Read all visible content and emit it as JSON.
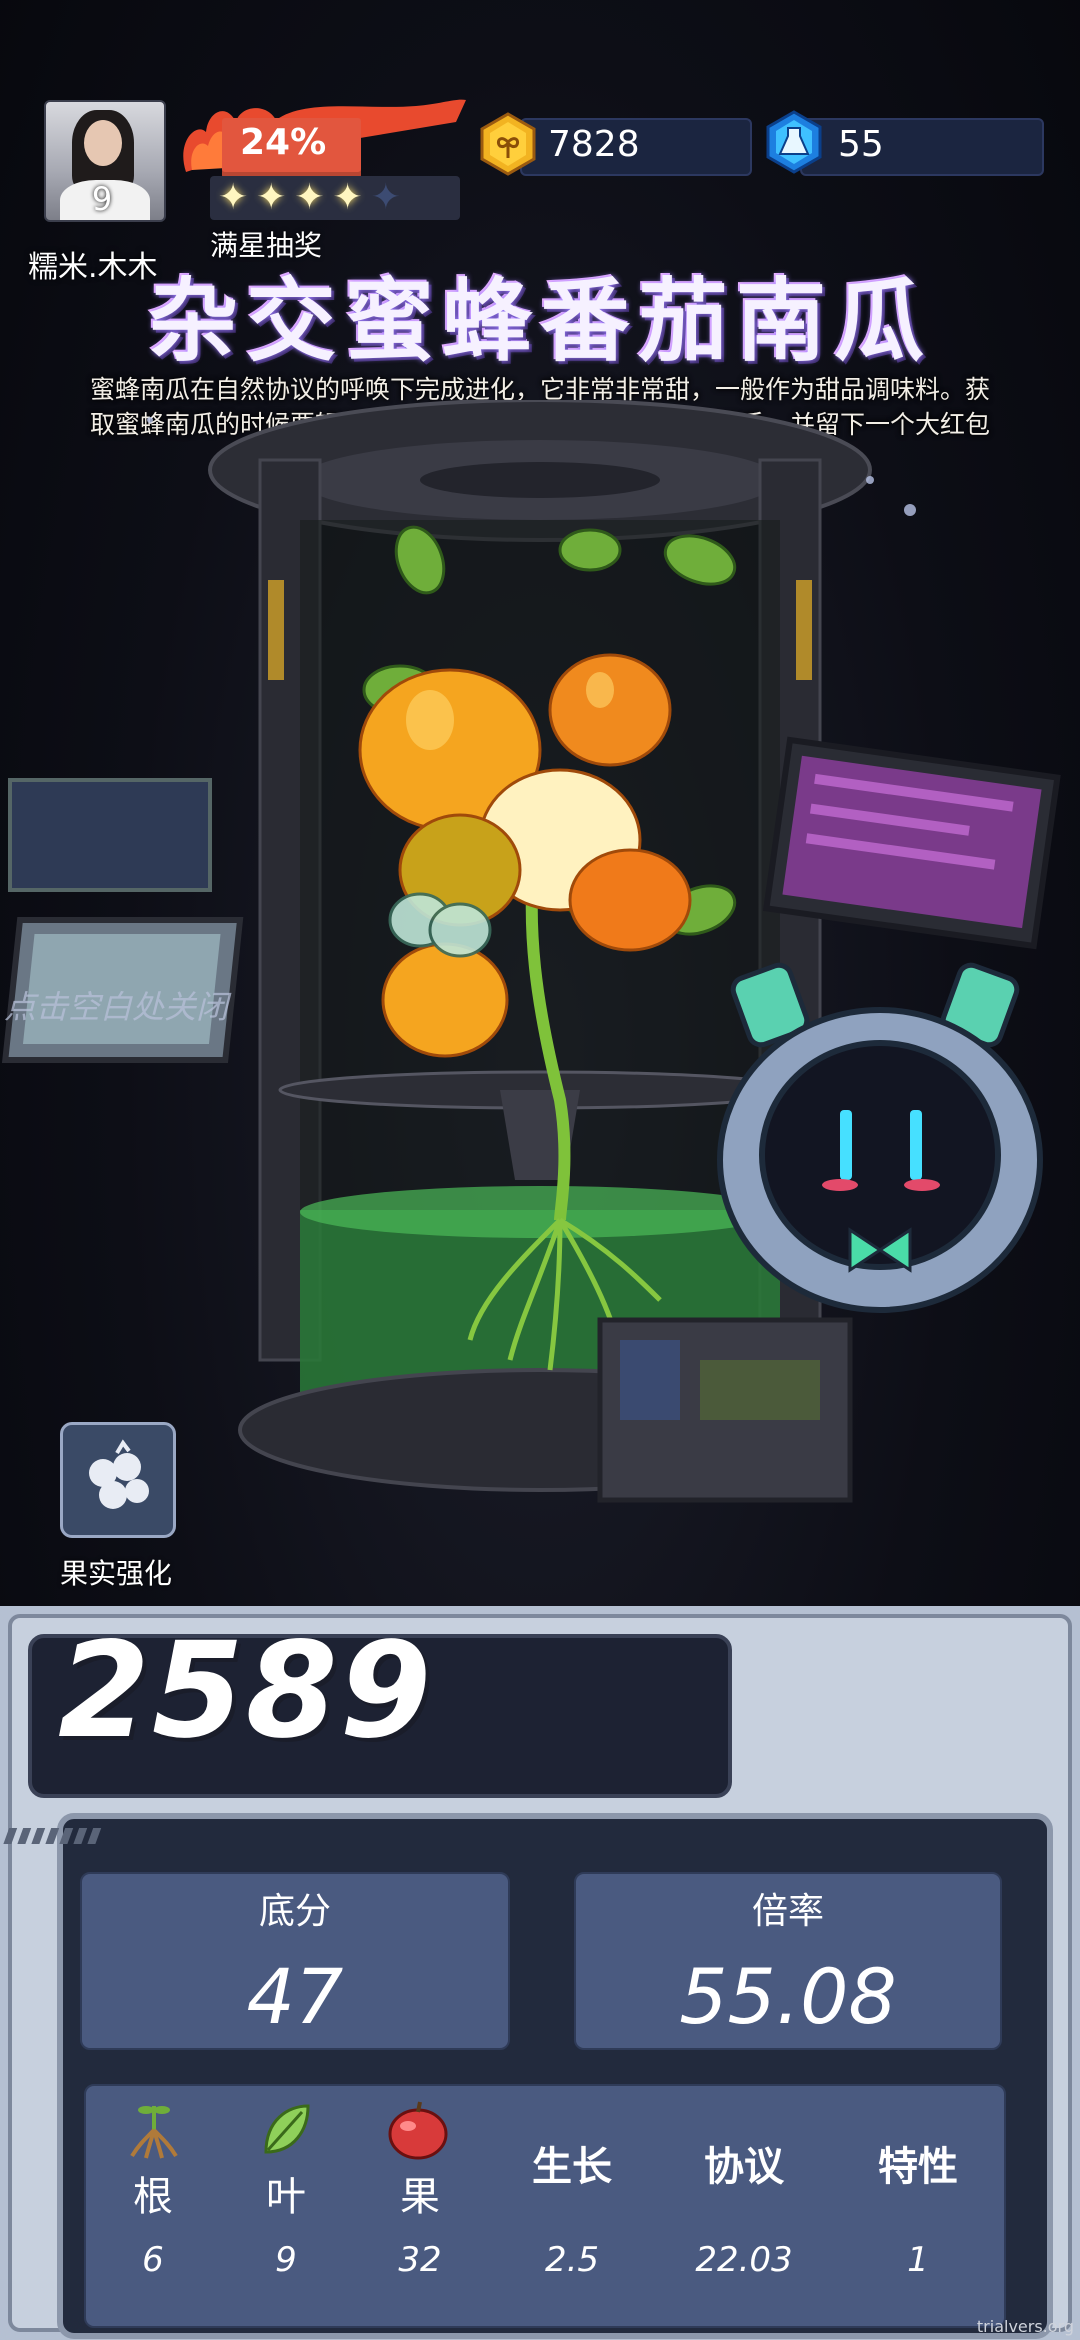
{
  "player": {
    "name": "糯米.木木",
    "level": "9"
  },
  "progress": {
    "percent_text": "24%",
    "percent": 0.24,
    "stars_filled": 4,
    "stars_total": 5,
    "reward_label": "满星抽奖"
  },
  "currency": {
    "coins": "7828",
    "gems": "55"
  },
  "item": {
    "title": "杂交蜜蜂番茄南瓜",
    "description": "蜜蜂南瓜在自然协议的呼唤下完成进化，它非常非常甜，一般作为甜品调味料。获取蜜蜂南瓜的时候要轻手轻脚，不然它会狠狠地亲吻你的双手，并留下一个大红包（肿包）。"
  },
  "hints": {
    "close": "点击空白处关闭"
  },
  "buttons": {
    "fruit_enhance": "果实强化"
  },
  "score": {
    "total": "2589",
    "base_label": "底分",
    "base_value": "47",
    "multiplier_label": "倍率",
    "multiplier_value": "55.08"
  },
  "attributes": [
    {
      "name": "根",
      "value": "6"
    },
    {
      "name": "叶",
      "value": "9"
    },
    {
      "name": "果",
      "value": "32"
    },
    {
      "name": "生长",
      "value": "2.5"
    },
    {
      "name": "协议",
      "value": "22.03"
    },
    {
      "name": "特性",
      "value": "1"
    }
  ],
  "watermark": "trialvers.org",
  "colors": {
    "xp_bar": "#e2563e",
    "panel": "#4a5a80",
    "coin": "#f2b321",
    "gem": "#2aa8ff"
  }
}
